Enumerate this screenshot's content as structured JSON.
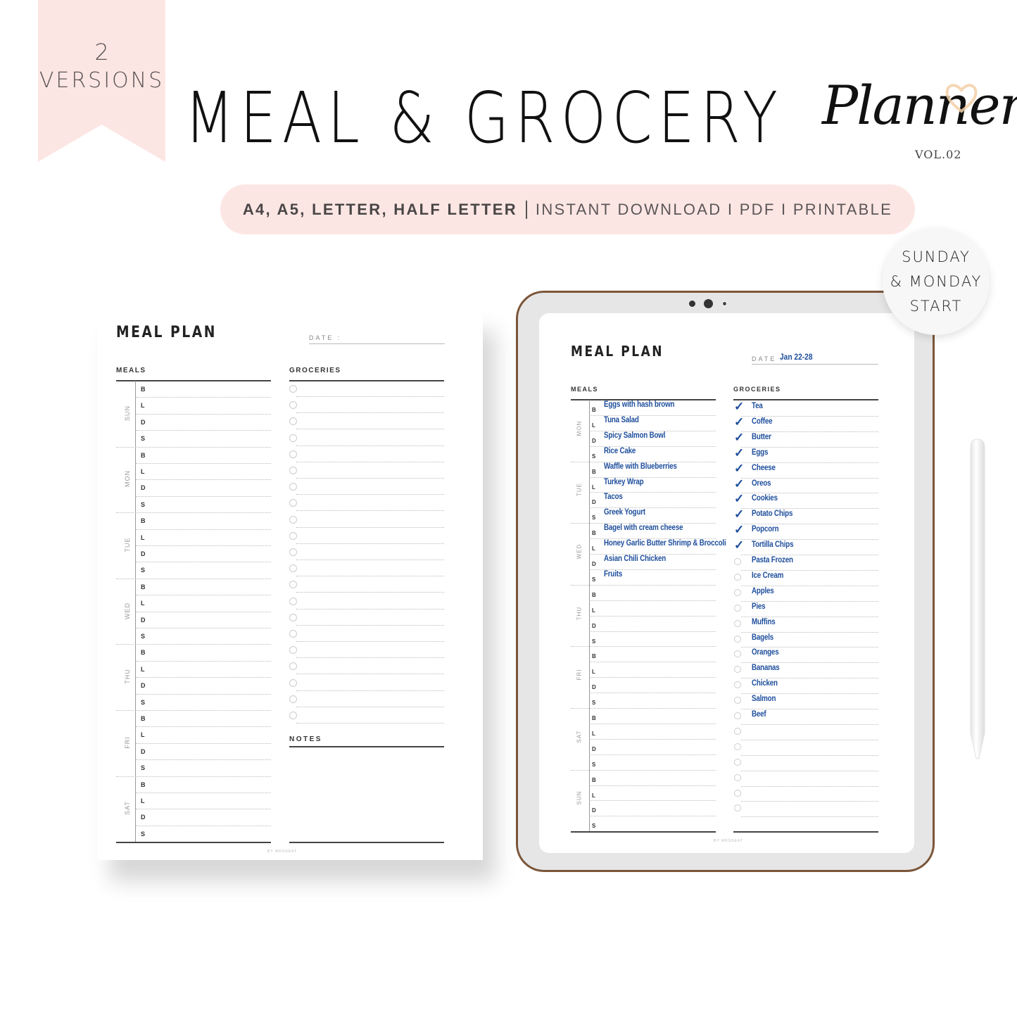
{
  "ribbon": {
    "number": "2",
    "text": "VERSIONS"
  },
  "header": {
    "title": "MEAL & GROCERY",
    "script": "Planner",
    "volume": "VOL.02",
    "heart_icon": "heart-icon"
  },
  "pill": {
    "sizes": "A4, A5, LETTER, HALF LETTER",
    "details": "INSTANT DOWNLOAD I PDF I PRINTABLE"
  },
  "badge": {
    "line1": "SUNDAY",
    "line2": "& MONDAY",
    "line3": "START"
  },
  "printable": {
    "title": "MEAL PLAN",
    "date_label": "DATE :",
    "meals_label": "MEALS",
    "groceries_label": "GROCERIES",
    "notes_label": "NOTES",
    "brand": "BY MRSNEAT",
    "days": [
      "SUN",
      "MON",
      "TUE",
      "WED",
      "THU",
      "FRI",
      "SAT"
    ],
    "meal_letters": [
      "B",
      "L",
      "D",
      "S"
    ],
    "grocery_slots": 21
  },
  "digital": {
    "title": "MEAL PLAN",
    "date_label": "DATE :",
    "date_value": "Jan 22-28",
    "meals_label": "MEALS",
    "groceries_label": "GROCERIES",
    "brand": "BY MRSNEAT",
    "days": [
      "MON",
      "TUE",
      "WED",
      "THU",
      "FRI",
      "SAT",
      "SUN"
    ],
    "meal_letters": [
      "B",
      "L",
      "D",
      "S"
    ],
    "meals": [
      "Eggs with hash brown",
      "Tuna Salad",
      "Spicy Salmon Bowl",
      "Rice Cake",
      "Waffle with Blueberries",
      "Turkey Wrap",
      "Tacos",
      "Greek Yogurt",
      "Bagel with cream cheese",
      "Honey Garlic Butter Shrimp & Broccoli",
      "Asian Chili Chicken",
      "Fruits"
    ],
    "groceries": [
      {
        "name": "Tea",
        "checked": true
      },
      {
        "name": "Coffee",
        "checked": true
      },
      {
        "name": "Butter",
        "checked": true
      },
      {
        "name": "Eggs",
        "checked": true
      },
      {
        "name": "Cheese",
        "checked": true
      },
      {
        "name": "Oreos",
        "checked": true
      },
      {
        "name": "Cookies",
        "checked": true
      },
      {
        "name": "Potato Chips",
        "checked": true
      },
      {
        "name": "Popcorn",
        "checked": true
      },
      {
        "name": "Tortilla Chips",
        "checked": true
      },
      {
        "name": "Pasta Frozen",
        "checked": false
      },
      {
        "name": "Ice Cream",
        "checked": false
      },
      {
        "name": "Apples",
        "checked": false
      },
      {
        "name": "Pies",
        "checked": false
      },
      {
        "name": "Muffins",
        "checked": false
      },
      {
        "name": "Bagels",
        "checked": false
      },
      {
        "name": "Oranges",
        "checked": false
      },
      {
        "name": "Bananas",
        "checked": false
      },
      {
        "name": "Chicken",
        "checked": false
      },
      {
        "name": "Salmon",
        "checked": false
      },
      {
        "name": "Beef",
        "checked": false
      },
      {
        "name": "",
        "checked": false
      },
      {
        "name": "",
        "checked": false
      },
      {
        "name": "",
        "checked": false
      },
      {
        "name": "",
        "checked": false
      },
      {
        "name": "",
        "checked": false
      },
      {
        "name": "",
        "checked": false
      }
    ]
  },
  "colors": {
    "pink": "#fce6e4",
    "ink_blue": "#1e4e9c",
    "tablet_frame": "#7b5538"
  }
}
